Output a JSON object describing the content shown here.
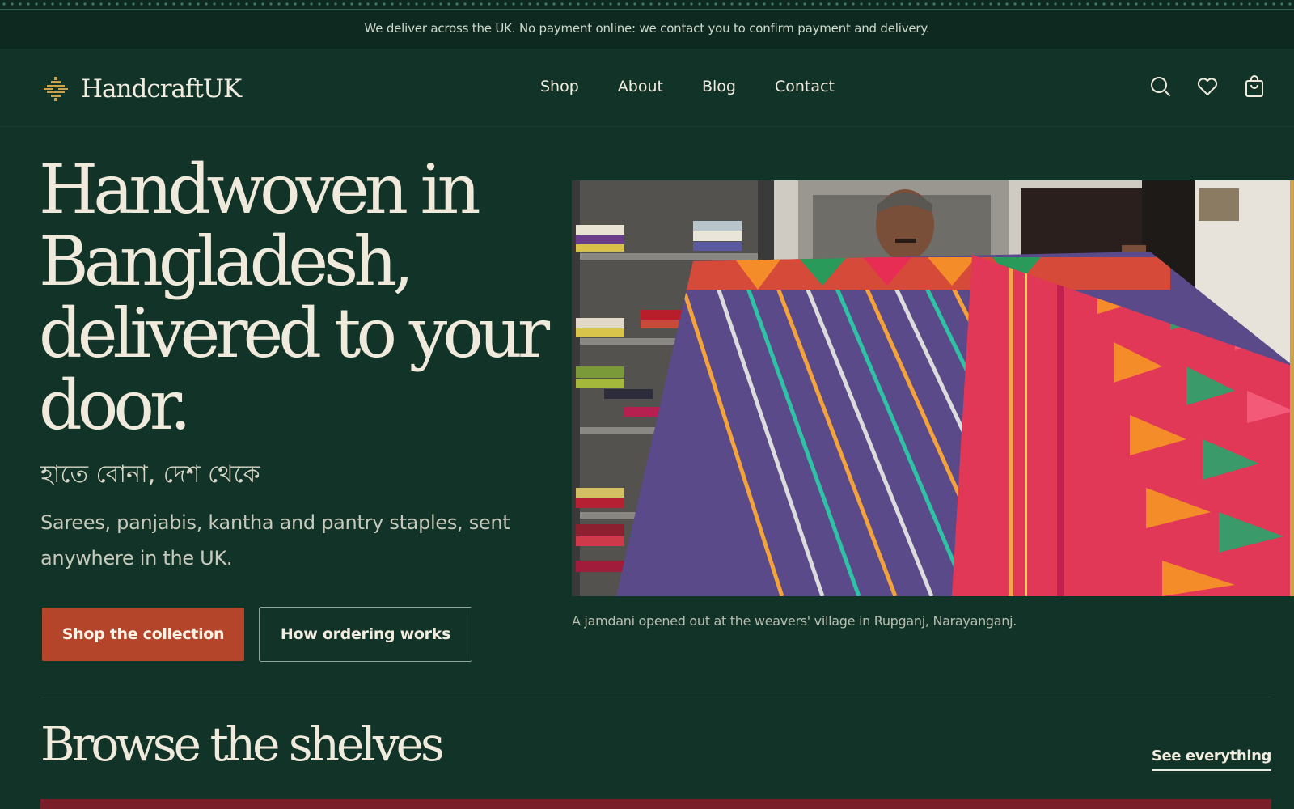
{
  "announcement": {
    "text": "We deliver across the UK. No payment online: we contact you to confirm payment and delivery."
  },
  "header": {
    "brand": "HandcraftUK",
    "nav": [
      {
        "label": "Shop"
      },
      {
        "label": "About"
      },
      {
        "label": "Blog"
      },
      {
        "label": "Contact"
      }
    ],
    "icons": [
      "search-icon",
      "heart-icon",
      "bag-icon"
    ]
  },
  "hero": {
    "title": "Handwoven in Bangladesh, delivered to your door.",
    "bengali": "হাতে বোনা, দেশ থেকে",
    "description": "Sarees, panjabis, kantha and pantry staples, sent anywhere in the UK.",
    "primary_button": "Shop the collection",
    "secondary_button": "How ordering works",
    "caption": "A jamdani opened out at the weavers' village in Rupganj, Narayanganj."
  },
  "browse": {
    "title": "Browse the shelves",
    "see_all": "See everything"
  },
  "colors": {
    "background": "#123327",
    "accent": "#b5452a",
    "brand_gold": "#c9a24a",
    "cream": "#efeadb"
  }
}
